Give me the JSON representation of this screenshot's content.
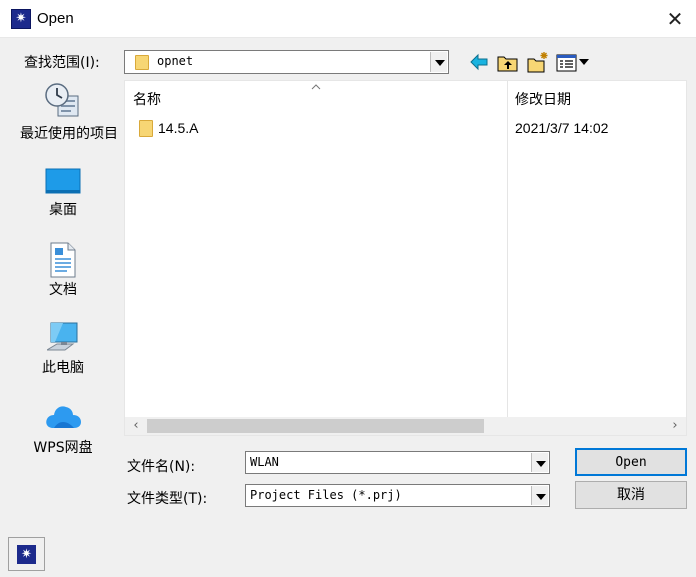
{
  "window": {
    "title": "Open",
    "close_glyph": "✕",
    "app_icon_glyph": "✷"
  },
  "lookin": {
    "label": "查找范围(I):",
    "value": "opnet"
  },
  "toolbar": {
    "icons": [
      "back-arrow-icon",
      "up-folder-icon",
      "new-folder-icon",
      "view-menu-icon"
    ]
  },
  "places": [
    {
      "name": "recent",
      "label": "最近使用的项目",
      "icon": "recent-items-icon"
    },
    {
      "name": "desktop",
      "label": "桌面",
      "icon": "desktop-icon"
    },
    {
      "name": "documents",
      "label": "文档",
      "icon": "documents-icon"
    },
    {
      "name": "this-pc",
      "label": "此电脑",
      "icon": "computer-icon"
    },
    {
      "name": "wps-drive",
      "label": "WPS网盘",
      "icon": "cloud-icon"
    }
  ],
  "list": {
    "columns": {
      "name": "名称",
      "modified": "修改日期"
    },
    "rows": [
      {
        "name": "14.5.A",
        "modified": "2021/3/7 14:02",
        "icon": "folder-icon"
      }
    ],
    "scroll_left_glyph": "‹",
    "scroll_right_glyph": "›"
  },
  "filename": {
    "label": "文件名(N):",
    "value": "WLAN"
  },
  "filetype": {
    "label": "文件类型(T):",
    "value": "Project Files (*.prj)"
  },
  "buttons": {
    "open": "Open",
    "cancel": "取消"
  },
  "colors": {
    "accent": "#0078d7",
    "folder": "#f7d674",
    "app_icon": "#1c2a8c"
  }
}
